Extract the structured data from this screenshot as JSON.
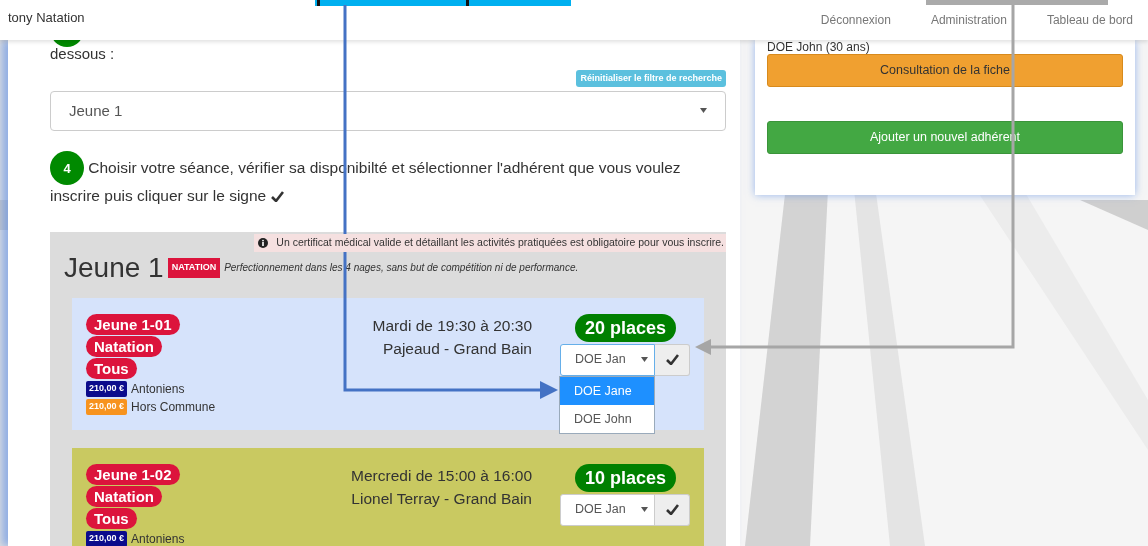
{
  "navbar": {
    "brand": "tony Natation",
    "links": [
      "Déconnexion",
      "Administration",
      "Tableau de bord"
    ]
  },
  "step3": {
    "text": "dessous :",
    "reset_badge": "Réinitialiser le filtre de recherche",
    "select_value": "Jeune 1"
  },
  "step4": {
    "number": "4",
    "text": "Choisir votre séance, vérifier sa disponibilté et sélectionner l'adhérent que vous voulez inscrire puis cliquer sur le signe"
  },
  "group": {
    "notice": "Un certificat médical valide et détaillant les activités pratiquées est obligatoire pour vous inscrire.",
    "title": "Jeune 1",
    "tag": "NATATION",
    "description": "Perfectionnement dans les 4 nages, sans but de compétition ni de performance.",
    "sessions": [
      {
        "color": "#d6e3fb",
        "tags": [
          "Jeune 1-01",
          "Natation",
          "Tous"
        ],
        "prices": [
          {
            "amount": "210,00 €",
            "label": "Antoniens",
            "color": "#0b0b8c"
          },
          {
            "amount": "210,00 €",
            "label": "Hors Commune",
            "color": "#f7931e"
          }
        ],
        "schedule": "Mardi de 19:30 à 20:30",
        "place": "Pajeaud - Grand Bain",
        "places": "20 places",
        "member": "DOE Jan",
        "expanded": true,
        "options": [
          {
            "label": "DOE Jane",
            "selected": true
          },
          {
            "label": "DOE John",
            "selected": false
          }
        ]
      },
      {
        "color": "#c9c961",
        "tags": [
          "Jeune 1-02",
          "Natation",
          "Tous"
        ],
        "prices": [
          {
            "amount": "210,00 €",
            "label": "Antoniens",
            "color": "#0b0b8c"
          }
        ],
        "schedule": "Mercredi de 15:00 à 16:00",
        "place": "Lionel Terray - Grand Bain",
        "places": "10 places",
        "member": "DOE Jan",
        "expanded": false
      }
    ]
  },
  "side": {
    "member": "DOE John (30 ans)",
    "buttons": [
      {
        "label": "Consultation de la fiche",
        "kind": "warning"
      },
      {
        "label": "Ajouter un nouvel adhérent",
        "kind": "success"
      }
    ]
  }
}
